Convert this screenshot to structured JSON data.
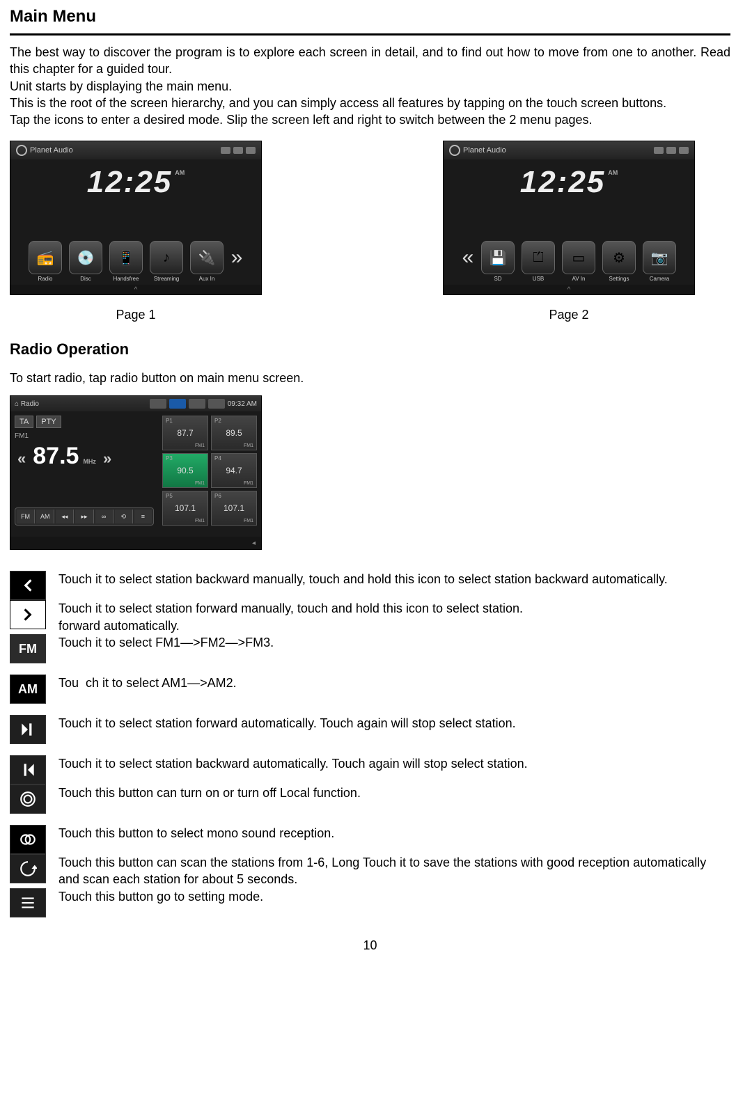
{
  "heading_main": "Main Menu",
  "intro": {
    "p1": "The best way to discover the program is to explore each screen in detail, and to find out how to move from one to another. Read this chapter for a guided tour.",
    "p2": "Unit starts by displaying the main menu.",
    "p3": "This is the root of the screen hierarchy, and you can simply access all features by tapping on the touch screen buttons.",
    "p4": "Tap the icons to enter a desired mode. Slip the screen left and right to switch between the 2 menu pages."
  },
  "brand": "Planet Audio",
  "clock_time": "12:25",
  "clock_ampm": "AM",
  "menu_page1": {
    "items": [
      {
        "label": "Radio",
        "glyph": "📻"
      },
      {
        "label": "Disc",
        "glyph": "💿"
      },
      {
        "label": "Handsfree",
        "glyph": "📱"
      },
      {
        "label": "Streaming",
        "glyph": "♪"
      },
      {
        "label": "Aux In",
        "glyph": "🔌"
      }
    ],
    "caption": "Page 1"
  },
  "menu_page2": {
    "items": [
      {
        "label": "SD",
        "glyph": "💾"
      },
      {
        "label": "USB",
        "glyph": "⏍"
      },
      {
        "label": "AV In",
        "glyph": "▭"
      },
      {
        "label": "Settings",
        "glyph": "⚙"
      },
      {
        "label": "Camera",
        "glyph": "📷"
      }
    ],
    "caption": "Page 2"
  },
  "heading_radio": "Radio Operation",
  "radio_intro": "To start radio, tap radio button on main menu screen.",
  "radio": {
    "title": "Radio",
    "time": "09:32 AM",
    "ta": "TA",
    "pty": "PTY",
    "band_label": "FM1",
    "freq": "87.5",
    "unit": "MHz",
    "controls": [
      "FM",
      "AM",
      "◂◂",
      "▸▸",
      "∞",
      "⟲",
      "≡"
    ],
    "presets": [
      {
        "n": "P1",
        "f": "87.7",
        "b": "FM1"
      },
      {
        "n": "P2",
        "f": "89.5",
        "b": "FM1"
      },
      {
        "n": "P3",
        "f": "90.5",
        "b": "FM1"
      },
      {
        "n": "P4",
        "f": "94.7",
        "b": "FM1"
      },
      {
        "n": "P5",
        "f": "107.1",
        "b": "FM1"
      },
      {
        "n": "P6",
        "f": "107.1",
        "b": "FM1"
      }
    ]
  },
  "descs": {
    "back_manual": "Touch it to select station backward manually, touch and hold this icon to select station backward automatically.",
    "fwd_manual_a": "Touch it to select station forward manually, touch and hold this icon to select station.",
    "fwd_manual_b": "forward automatically.",
    "fm": "Touch it to select FM1—>FM2—>FM3.",
    "am_a": "Tou",
    "am_b": "ch it to select AM1—>AM2.",
    "fwd_auto": "Touch it to select station forward automatically. Touch again will stop select station.",
    "back_auto": "Touch it to select station backward automatically. Touch again will stop select station.",
    "local": "Touch this button can turn on or turn off Local function.",
    "mono": "Touch this button to select mono sound reception.",
    "scan": "Touch this button can scan the stations from 1-6, Long Touch it to save the stations with good reception automatically and scan each station for about 5 seconds.",
    "setting": "Touch this button go to setting mode."
  },
  "icon_labels": {
    "fm": "FM",
    "am": "AM"
  },
  "page_number": "10"
}
